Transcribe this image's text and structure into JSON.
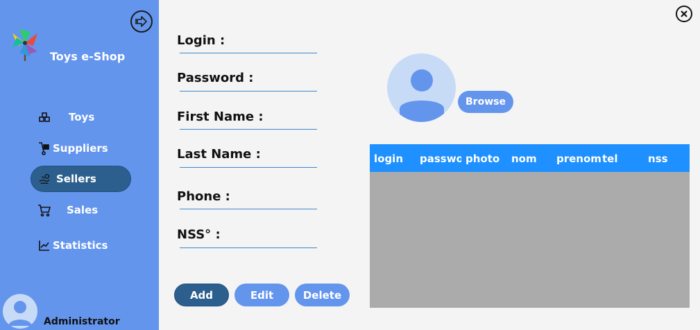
{
  "app": {
    "title": "Toys e-Shop"
  },
  "sidebar": {
    "items": [
      {
        "label": "Toys"
      },
      {
        "label": "Suppliers"
      },
      {
        "label": "Sellers"
      },
      {
        "label": "Sales"
      },
      {
        "label": "Statistics"
      }
    ],
    "active": "Sellers",
    "user": "Administrator"
  },
  "form": {
    "login_label": "Login :",
    "password_label": "Password :",
    "firstname_label": "First Name :",
    "lastname_label": "Last Name :",
    "phone_label": "Phone :",
    "nss_label": "NSS° :"
  },
  "photo": {
    "browse_label": "Browse"
  },
  "table": {
    "columns": [
      "login",
      "passwor",
      "photo",
      "nom",
      "prenom",
      "tel",
      "nss"
    ],
    "rows": []
  },
  "actions": {
    "add": "Add",
    "edit": "Edit",
    "delete": "Delete"
  },
  "colors": {
    "sidebar": "#6495ed",
    "active_item": "#2d5f8e",
    "table_header": "#1e90ff",
    "table_body": "#ababab",
    "background": "#f4f4f5"
  }
}
